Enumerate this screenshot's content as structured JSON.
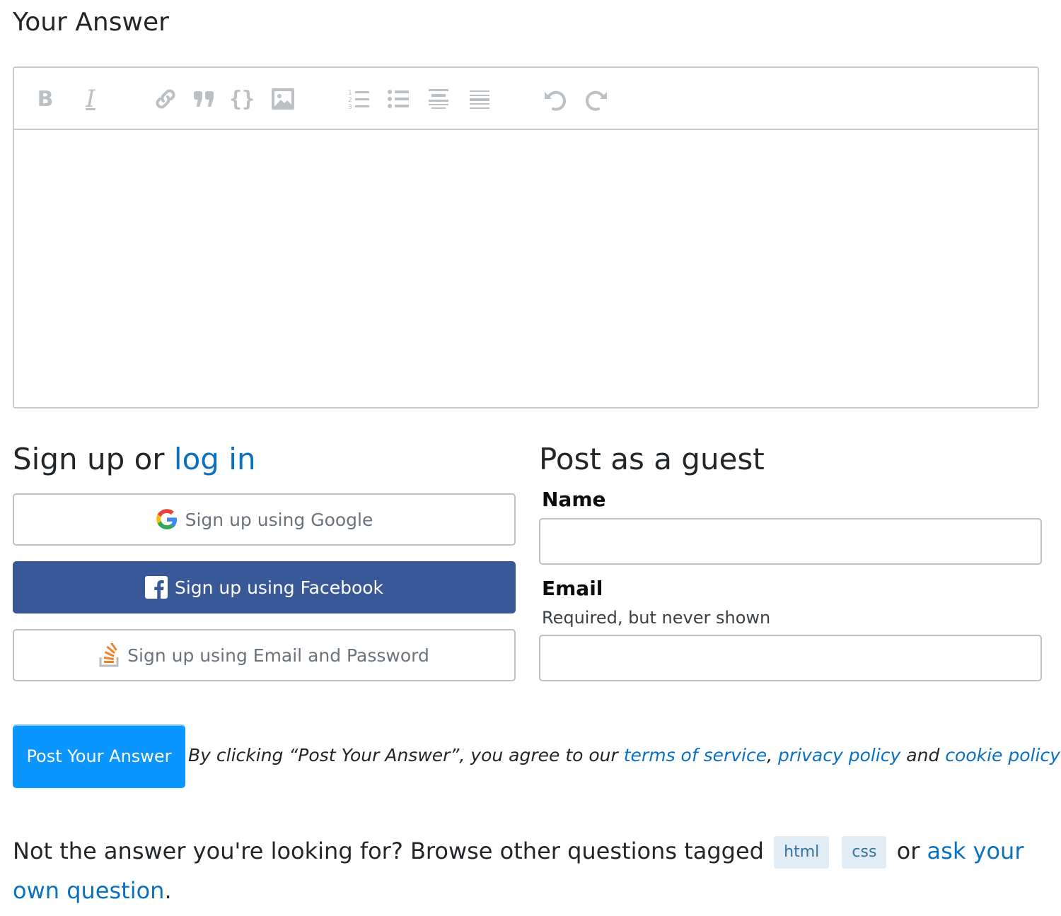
{
  "answer_section": {
    "title": "Your Answer"
  },
  "toolbar": {
    "buttons": [
      {
        "name": "bold",
        "icon": "bold-icon",
        "glyph": "B"
      },
      {
        "name": "italic",
        "icon": "italic-icon",
        "glyph": "I"
      },
      {
        "name": "link",
        "icon": "link-icon"
      },
      {
        "name": "blockquote",
        "icon": "quote-icon"
      },
      {
        "name": "code",
        "icon": "code-braces-icon",
        "glyph": "{}"
      },
      {
        "name": "image",
        "icon": "image-icon"
      },
      {
        "name": "ordered-list",
        "icon": "numbered-list-icon"
      },
      {
        "name": "bulleted-list",
        "icon": "bulleted-list-icon"
      },
      {
        "name": "heading",
        "icon": "heading-icon"
      },
      {
        "name": "horizontal-rule",
        "icon": "horizontal-rule-icon"
      },
      {
        "name": "undo",
        "icon": "undo-icon"
      },
      {
        "name": "redo",
        "icon": "redo-icon"
      }
    ]
  },
  "signup": {
    "title_prefix": "Sign up or ",
    "login_link": "log in",
    "google_label": "Sign up using Google",
    "facebook_label": "Sign up using Facebook",
    "email_label": "Sign up using Email and Password"
  },
  "guest": {
    "title": "Post as a guest",
    "name_label": "Name",
    "name_value": "",
    "email_label": "Email",
    "email_description": "Required, but never shown",
    "email_value": ""
  },
  "post": {
    "button_label": "Post Your Answer",
    "terms_prefix": "By clicking “Post Your Answer”, you agree to our ",
    "terms_link": "terms of service",
    "comma": ", ",
    "privacy_link": "privacy policy",
    "and": " and ",
    "cookie_link": "cookie policy"
  },
  "footer": {
    "prefix": "Not the answer you're looking for? Browse other questions tagged ",
    "tags": [
      "html",
      "css"
    ],
    "or": " or ",
    "ask_link": "ask your own question",
    "suffix": "."
  },
  "colors": {
    "accent_link": "#0a70c0",
    "post_button": "#0a95ff",
    "facebook": "#395898",
    "tag_bg": "#e1ecf4",
    "tag_text": "#39739d"
  }
}
